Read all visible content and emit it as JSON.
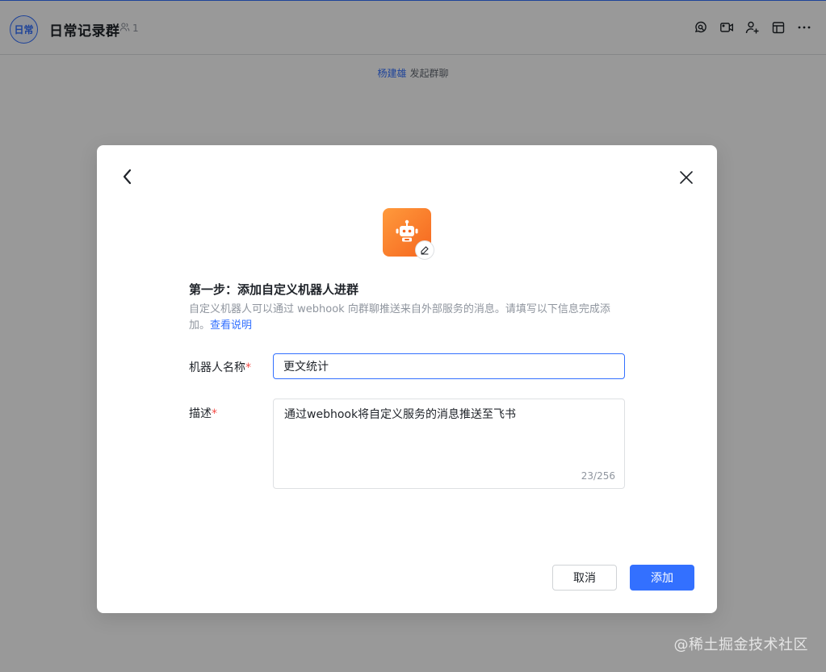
{
  "header": {
    "avatar_text": "日常",
    "title": "日常记录群",
    "member_count": "1",
    "tools": [
      "search-chat-icon",
      "video-icon",
      "add-member-icon",
      "calendar-icon",
      "more-icon"
    ]
  },
  "system_message": {
    "user": "杨建雄",
    "action": "发起群聊"
  },
  "modal": {
    "step_title": "第一步：添加自定义机器人进群",
    "step_desc": "自定义机器人可以通过 webhook 向群聊推送来自外部服务的消息。请填写以下信息完成添加。",
    "help_link": "查看说明",
    "name_label": "机器人名称",
    "name_value": "更文统计",
    "desc_label": "描述",
    "desc_value": "通过webhook将自定义服务的消息推送至飞书",
    "char_count": "23/256",
    "required_mark": "*",
    "cancel_label": "取消",
    "add_label": "添加"
  },
  "colors": {
    "primary": "#3370ff",
    "bot_gradient_start": "#ff9a3c",
    "bot_gradient_end": "#f5661f",
    "required": "#f54a45"
  },
  "watermark": "@稀土掘金技术社区"
}
